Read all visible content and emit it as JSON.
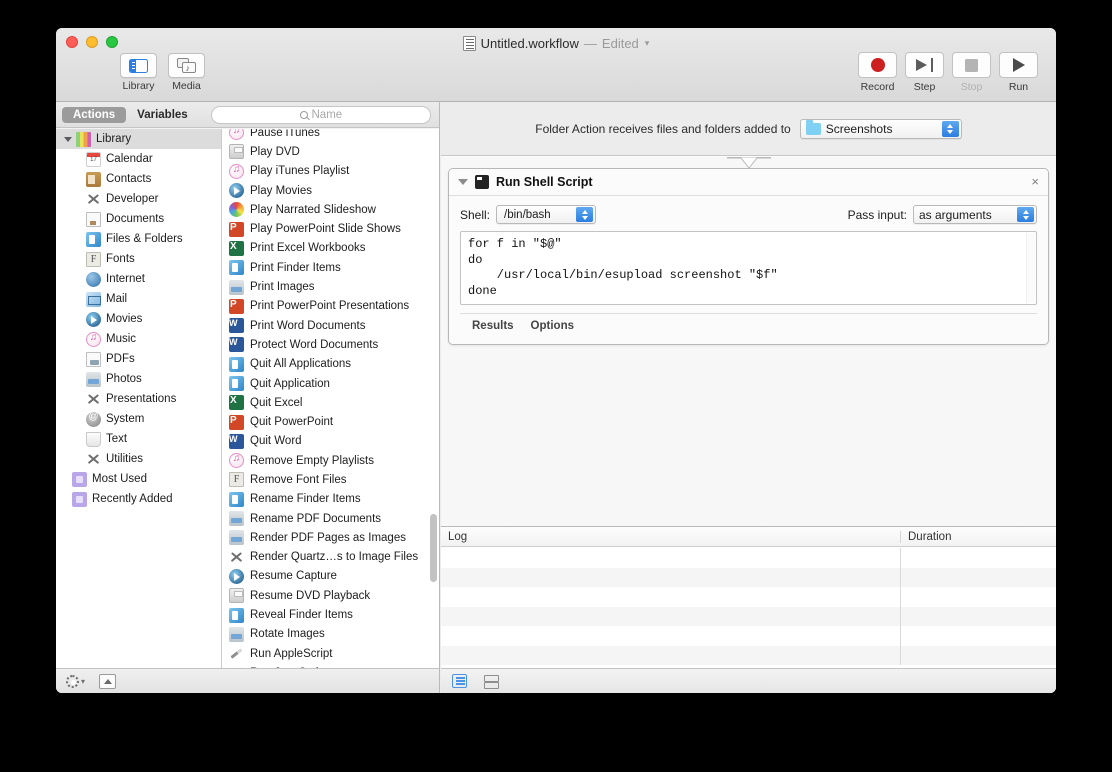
{
  "window": {
    "title": "Untitled.workflow",
    "title_separator": "—",
    "edited_label": "Edited",
    "doc_icon": "workflow-document-icon"
  },
  "toolbar": {
    "left_buttons": [
      {
        "label": "Library",
        "icon": "library-sidebar-icon",
        "active": true
      },
      {
        "label": "Media",
        "icon": "media-frames-icon",
        "active": false
      }
    ],
    "right_buttons": [
      {
        "label": "Record",
        "icon": "record-circle-icon",
        "enabled": true
      },
      {
        "label": "Step",
        "icon": "step-forward-icon",
        "enabled": true
      },
      {
        "label": "Stop",
        "icon": "stop-square-icon",
        "enabled": false
      },
      {
        "label": "Run",
        "icon": "run-triangle-icon",
        "enabled": true
      }
    ]
  },
  "left_pane": {
    "tabs": [
      {
        "label": "Actions",
        "selected": true
      },
      {
        "label": "Variables",
        "selected": false
      }
    ],
    "search": {
      "placeholder": "Name",
      "value": "",
      "icon": "search-icon"
    },
    "tree": {
      "root": {
        "label": "Library",
        "icon": "library-colors-icon",
        "expanded": true
      },
      "children": [
        {
          "label": "Calendar",
          "icon": "calendar-icon"
        },
        {
          "label": "Contacts",
          "icon": "contacts-icon"
        },
        {
          "label": "Developer",
          "icon": "developer-icon"
        },
        {
          "label": "Documents",
          "icon": "documents-icon"
        },
        {
          "label": "Files & Folders",
          "icon": "finder-icon"
        },
        {
          "label": "Fonts",
          "icon": "fonts-icon"
        },
        {
          "label": "Internet",
          "icon": "internet-globe-icon"
        },
        {
          "label": "Mail",
          "icon": "mail-icon"
        },
        {
          "label": "Movies",
          "icon": "quicktime-movies-icon"
        },
        {
          "label": "Music",
          "icon": "itunes-music-icon"
        },
        {
          "label": "PDFs",
          "icon": "pdf-icon"
        },
        {
          "label": "Photos",
          "icon": "photos-icon"
        },
        {
          "label": "Presentations",
          "icon": "presentations-icon"
        },
        {
          "label": "System",
          "icon": "system-icon"
        },
        {
          "label": "Text",
          "icon": "text-icon"
        },
        {
          "label": "Utilities",
          "icon": "utilities-icon"
        }
      ],
      "smart_groups": [
        {
          "label": "Most Used",
          "icon": "smart-folder-icon"
        },
        {
          "label": "Recently Added",
          "icon": "smart-folder-icon"
        }
      ]
    },
    "actions": [
      {
        "label": "Pause iTunes",
        "icon": "itunes-music-icon"
      },
      {
        "label": "Play DVD",
        "icon": "dvd-player-icon"
      },
      {
        "label": "Play iTunes Playlist",
        "icon": "itunes-music-icon"
      },
      {
        "label": "Play Movies",
        "icon": "quicktime-movies-icon"
      },
      {
        "label": "Play Narrated Slideshow",
        "icon": "slideshow-icon"
      },
      {
        "label": "Play PowerPoint Slide Shows",
        "icon": "powerpoint-icon"
      },
      {
        "label": "Print Excel Workbooks",
        "icon": "excel-icon"
      },
      {
        "label": "Print Finder Items",
        "icon": "finder-icon"
      },
      {
        "label": "Print Images",
        "icon": "photos-icon"
      },
      {
        "label": "Print PowerPoint Presentations",
        "icon": "powerpoint-icon"
      },
      {
        "label": "Print Word Documents",
        "icon": "word-icon"
      },
      {
        "label": "Protect Word Documents",
        "icon": "word-icon"
      },
      {
        "label": "Quit All Applications",
        "icon": "finder-icon"
      },
      {
        "label": "Quit Application",
        "icon": "finder-icon"
      },
      {
        "label": "Quit Excel",
        "icon": "excel-icon"
      },
      {
        "label": "Quit PowerPoint",
        "icon": "powerpoint-icon"
      },
      {
        "label": "Quit Word",
        "icon": "word-icon"
      },
      {
        "label": "Remove Empty Playlists",
        "icon": "itunes-music-icon"
      },
      {
        "label": "Remove Font Files",
        "icon": "fonts-icon"
      },
      {
        "label": "Rename Finder Items",
        "icon": "finder-icon"
      },
      {
        "label": "Rename PDF Documents",
        "icon": "photos-icon"
      },
      {
        "label": "Render PDF Pages as Images",
        "icon": "photos-icon"
      },
      {
        "label": "Render Quartz…s to Image Files",
        "icon": "utilities-icon"
      },
      {
        "label": "Resume Capture",
        "icon": "quicktime-movies-icon"
      },
      {
        "label": "Resume DVD Playback",
        "icon": "dvd-player-icon"
      },
      {
        "label": "Reveal Finder Items",
        "icon": "finder-icon"
      },
      {
        "label": "Rotate Images",
        "icon": "photos-icon"
      },
      {
        "label": "Run AppleScript",
        "icon": "applescript-icon"
      },
      {
        "label": "Run JavaScript",
        "icon": "applescript-icon"
      }
    ],
    "bottom_bar": {
      "gear_menu": "action-gear-menu",
      "disclosure": "show-description-button"
    }
  },
  "workflow": {
    "folder_action": {
      "prompt": "Folder Action receives files and folders added to",
      "folder_value": "Screenshots",
      "folder_icon": "folder-icon"
    },
    "action_card": {
      "title": "Run Shell Script",
      "icon": "shell-script-icon",
      "close_label": "×",
      "expanded": true,
      "shell_label": "Shell:",
      "shell_value": "/bin/bash",
      "pass_input_label": "Pass input:",
      "pass_input_value": "as arguments",
      "script": "for f in \"$@\"\ndo\n    /usr/local/bin/esupload screenshot \"$f\"\ndone",
      "footer_tabs": [
        {
          "label": "Results"
        },
        {
          "label": "Options"
        }
      ]
    }
  },
  "log": {
    "columns": [
      "Log",
      "Duration"
    ],
    "rows": [],
    "row_count": 6,
    "view_buttons": [
      {
        "name": "log-view-button",
        "selected": true
      },
      {
        "name": "split-view-button",
        "selected": false
      }
    ]
  },
  "colors": {
    "accent_blue": "#2b7de0",
    "record_red": "#cc1f1f",
    "window_chrome": "#ececec",
    "selection_gray": "#9b9b9b"
  }
}
